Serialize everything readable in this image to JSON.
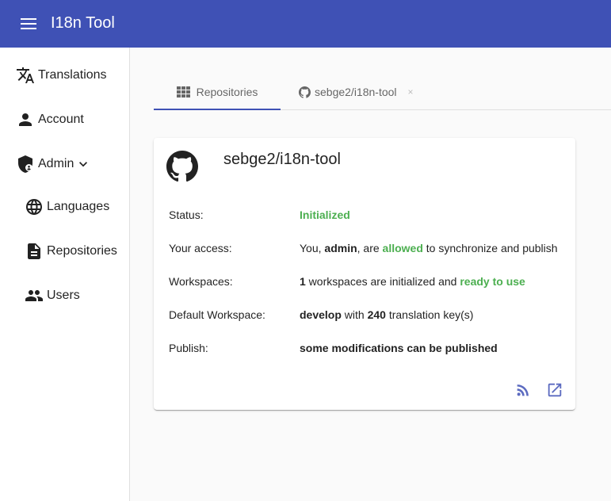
{
  "app": {
    "title": "I18n Tool"
  },
  "sidebar": {
    "translations": "Translations",
    "account": "Account",
    "admin": "Admin",
    "languages": "Languages",
    "repositories": "Repositories",
    "users": "Users"
  },
  "tabs": [
    {
      "label": "Repositories",
      "active": true
    },
    {
      "label": "sebge2/i18n-tool",
      "close": "×"
    }
  ],
  "card": {
    "title": "sebge2/i18n-tool",
    "status": {
      "label": "Status:",
      "value": "Initialized"
    },
    "access": {
      "label": "Your access:",
      "p1": "You, ",
      "user": "admin",
      "p2": ", are ",
      "allowed": "allowed",
      "p3": " to synchronize and publish"
    },
    "workspaces": {
      "label": "Workspaces:",
      "count": "1",
      "p1": " workspaces are initialized and ",
      "ready": "ready to use"
    },
    "default_workspace": {
      "label": "Default Workspace:",
      "name": "develop",
      "p1": " with ",
      "keys": "240",
      "p2": " translation key(s)"
    },
    "publish": {
      "label": "Publish:",
      "value": "some modifications can be published"
    }
  },
  "colors": {
    "primary": "#3f51b5",
    "success": "#4caf50",
    "action_icon": "#5c6bc0"
  },
  "icons": [
    "menu-icon",
    "translate-icon",
    "person-icon",
    "admin-shield-icon",
    "chevron-down-icon",
    "globe-icon",
    "document-icon",
    "group-icon",
    "grid-icon",
    "github-icon",
    "rss-icon",
    "open-external-icon"
  ]
}
